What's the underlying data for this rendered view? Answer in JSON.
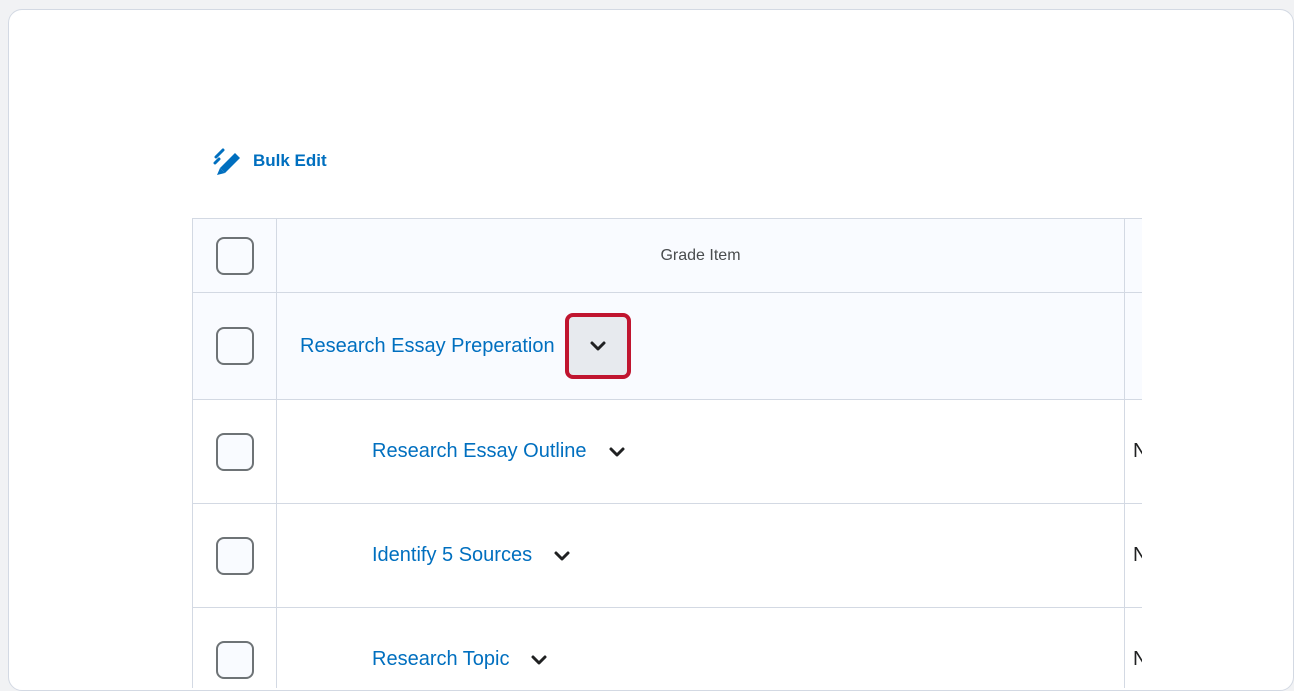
{
  "toolbar": {
    "bulk_edit_label": "Bulk Edit",
    "bulk_edit_icon": "pencil-icon"
  },
  "table": {
    "columns": [
      "Grade Item"
    ],
    "rows": [
      {
        "name": "Research Essay Preperation",
        "type": "",
        "level": 0,
        "kind": "category"
      },
      {
        "name": "Research Essay Outline",
        "type": "Nu",
        "level": 1,
        "kind": "item"
      },
      {
        "name": "Identify 5 Sources",
        "type": "Nu",
        "level": 1,
        "kind": "item"
      },
      {
        "name": "Research Topic",
        "type": "Nu",
        "level": 1,
        "kind": "item"
      }
    ]
  },
  "colors": {
    "link": "#006fbf",
    "highlight_border": "#c0152f",
    "row_tint": "#f9fbff",
    "border": "#d3d9e3"
  }
}
